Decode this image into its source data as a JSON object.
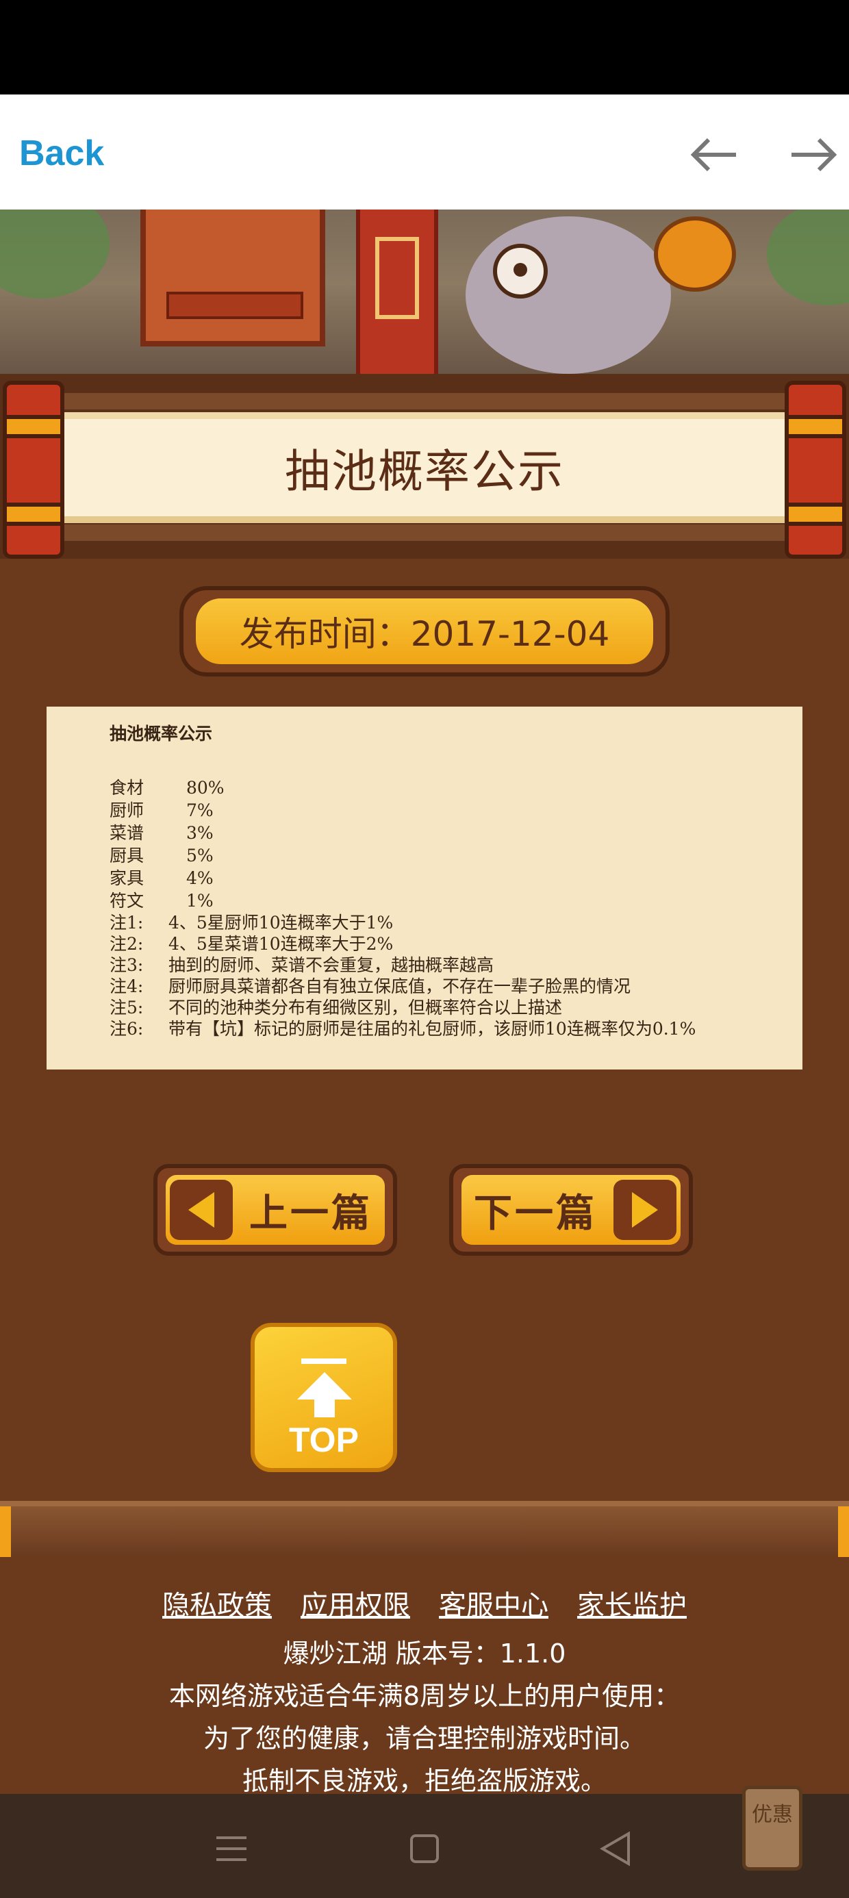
{
  "nav": {
    "back_label": "Back",
    "prev_arrow": "arrow-left-icon",
    "next_arrow": "arrow-right-icon"
  },
  "page": {
    "title": "抽池概率公示",
    "date_label": "发布时间：2017-12-04"
  },
  "notice": {
    "heading": "抽池概率公示",
    "rates": [
      {
        "item": "食材",
        "value": "80%"
      },
      {
        "item": "厨师",
        "value": "7%"
      },
      {
        "item": "菜谱",
        "value": "3%"
      },
      {
        "item": "厨具",
        "value": "5%"
      },
      {
        "item": "家具",
        "value": "4%"
      },
      {
        "item": "符文",
        "value": "1%"
      }
    ],
    "notes": [
      {
        "label": "注1:",
        "text": "4、5星厨师10连概率大于1%"
      },
      {
        "label": "注2:",
        "text": "4、5星菜谱10连概率大于2%"
      },
      {
        "label": "注3:",
        "text": "抽到的厨师、菜谱不会重复，越抽概率越高"
      },
      {
        "label": "注4:",
        "text": "厨师厨具菜谱都各自有独立保底值，不存在一辈子脸黑的情况"
      },
      {
        "label": "注5:",
        "text": "不同的池种类分布有细微区别，但概率符合以上描述"
      },
      {
        "label": "注6:",
        "text": "带有【坑】标记的厨师是往届的礼包厨师，该厨师10连概率仅为0.1%"
      }
    ]
  },
  "pager": {
    "prev_label": "上一篇",
    "next_label": "下一篇"
  },
  "top_button": {
    "label": "TOP"
  },
  "footer": {
    "links": [
      "隐私政策",
      "应用权限",
      "客服中心",
      "家长监护"
    ],
    "version_line": "爆炒江湖 版本号：1.1.0",
    "age_line": "本网络游戏适合年满8周岁以上的用户使用：",
    "health_line": "为了您的健康，请合理控制游戏时间。",
    "anti_piracy_line": "抵制不良游戏，拒绝盗版游戏。"
  },
  "promo_tag": "优惠",
  "colors": {
    "link_blue": "#1e95d3",
    "page_brown": "#6b3a1c",
    "accent_gold": "#f0a515",
    "paper": "#f7e6c3"
  }
}
